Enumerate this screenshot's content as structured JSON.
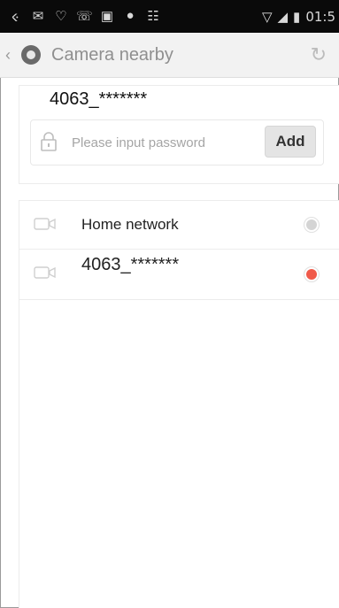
{
  "statusbar": {
    "time": "01:5",
    "left_icons": [
      "ime-icon",
      "mail-icon",
      "wifi-alt-icon",
      "phone-icon",
      "save-icon",
      "chat-icon",
      "mms-icon"
    ],
    "right_icons": [
      "wifi-icon",
      "signal-icon",
      "battery-icon"
    ]
  },
  "titlebar": {
    "title": "Camera nearby"
  },
  "add_panel": {
    "ssid": "4063_*******",
    "password_placeholder": "Please input password",
    "add_label": "Add"
  },
  "list": {
    "items": [
      {
        "label": "Home network",
        "status": "inactive"
      },
      {
        "label": "4063_*******",
        "status": "active"
      }
    ]
  },
  "colors": {
    "active_dot": "#f05a4a",
    "inactive_dot": "#d4d4d4"
  }
}
